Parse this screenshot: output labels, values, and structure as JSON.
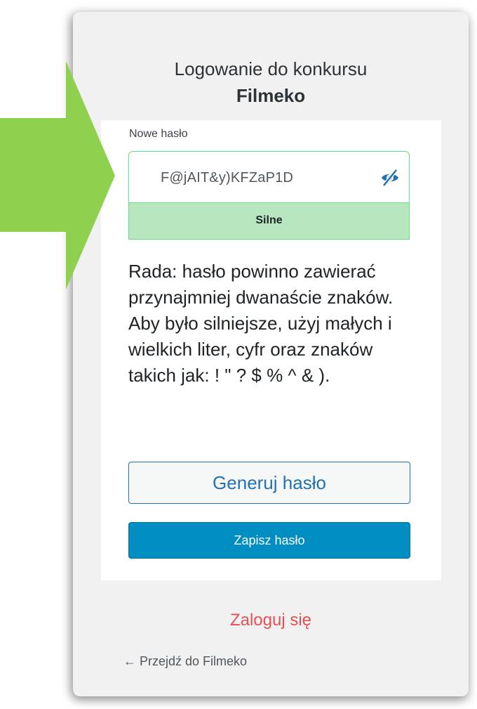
{
  "header": {
    "title": "Logowanie do konkursu",
    "brand": "Filmeko"
  },
  "form": {
    "field_label": "Nowe hasło",
    "password_value": "F@jAIT&y)KFZaP1D",
    "eye_icon": "eye-slash-icon",
    "strength_label": "Silne",
    "hint": "Rada: hasło powinno zawierać przynajmniej dwanaście znaków. Aby było silniejsze, użyj małych i wielkich liter, cyfr oraz znaków takich jak: ! \" ? $ % ^ & ).",
    "generate_label": "Generuj hasło",
    "save_label": "Zapisz hasło"
  },
  "footer": {
    "login_link": "Zaloguj się",
    "back_link": "← Przejdź do Filmeko"
  },
  "colors": {
    "arrow": "#8fd14f",
    "strength_bg": "#b8e6bf",
    "primary": "#008ec2",
    "link_red": "#e65054"
  }
}
